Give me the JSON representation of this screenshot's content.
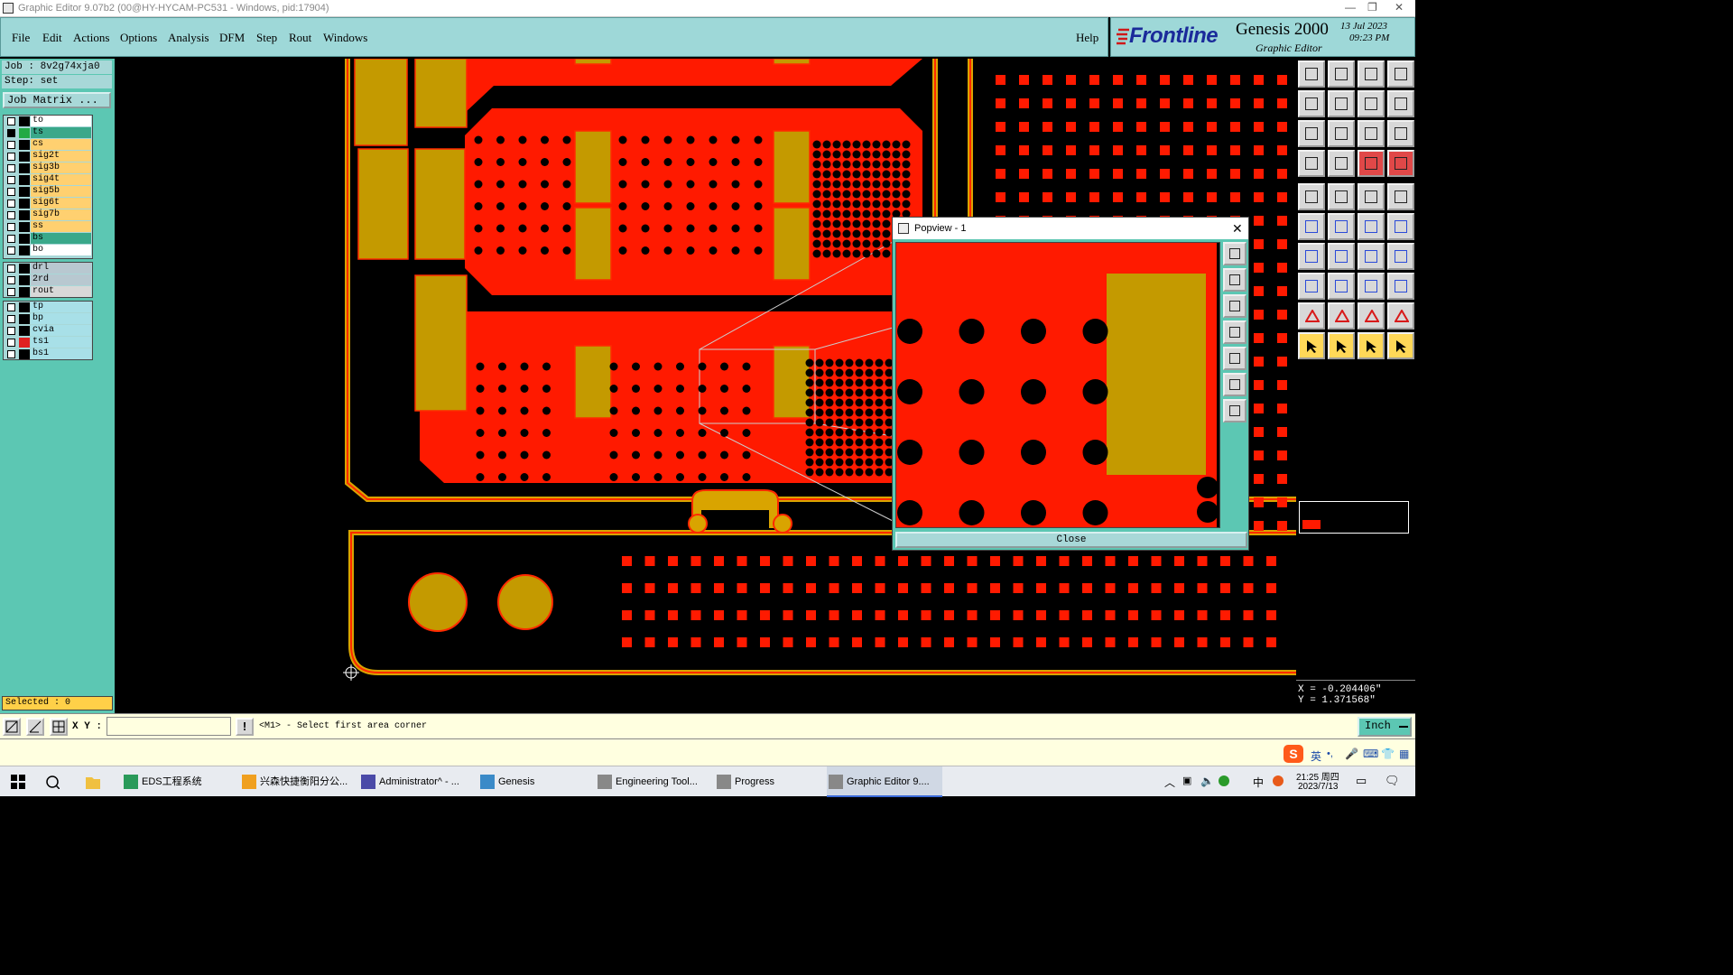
{
  "window": {
    "title": "Graphic Editor 9.07b2 (00@HY-HYCAM-PC531 - Windows, pid:17904)",
    "min": "—",
    "max": "❐",
    "close": "✕"
  },
  "menu": {
    "file": "File",
    "edit": "Edit",
    "actions": "Actions",
    "options": "Options",
    "analysis": "Analysis",
    "dfm": "DFM",
    "step": "Step",
    "rout": "Rout",
    "windows": "Windows",
    "help": "Help"
  },
  "brand": {
    "logo": "Frontline",
    "product": "Genesis 2000",
    "subtitle": "Graphic Editor",
    "date": "13 Jul 2023",
    "time": "09:23 PM"
  },
  "job": {
    "job_line": "Job : 8v2g74xja0",
    "step_line": "Step: set",
    "matrix_button": "Job Matrix ..."
  },
  "layers_group1": [
    {
      "name": "to",
      "color": "#ffffff",
      "swatch": "#000000",
      "checked": false
    },
    {
      "name": "ts",
      "color": "#3aa88a",
      "swatch": "#22aa44",
      "checked": true
    },
    {
      "name": "cs",
      "color": "#ffd070",
      "swatch": "#000000",
      "checked": false
    },
    {
      "name": "sig2t",
      "color": "#ffd070",
      "swatch": "#000000",
      "checked": false
    },
    {
      "name": "sig3b",
      "color": "#ffd070",
      "swatch": "#000000",
      "checked": false
    },
    {
      "name": "sig4t",
      "color": "#ffd070",
      "swatch": "#000000",
      "checked": false
    },
    {
      "name": "sig5b",
      "color": "#ffd070",
      "swatch": "#000000",
      "checked": false
    },
    {
      "name": "sig6t",
      "color": "#ffd070",
      "swatch": "#000000",
      "checked": false
    },
    {
      "name": "sig7b",
      "color": "#ffd070",
      "swatch": "#000000",
      "checked": false
    },
    {
      "name": "ss",
      "color": "#ffd070",
      "swatch": "#000000",
      "checked": false
    },
    {
      "name": "bs",
      "color": "#3aa88a",
      "swatch": "#000000",
      "checked": false
    },
    {
      "name": "bo",
      "color": "#ffffff",
      "swatch": "#000000",
      "checked": false
    }
  ],
  "layers_group2": [
    {
      "name": "drl",
      "color": "#b8c8d0",
      "swatch": "#000000",
      "checked": false
    },
    {
      "name": "2rd",
      "color": "#b8c8d0",
      "swatch": "#000000",
      "checked": false
    },
    {
      "name": "rout",
      "color": "#d8d8d8",
      "swatch": "#000000",
      "checked": false
    }
  ],
  "layers_group3": [
    {
      "name": "tp",
      "color": "#a8e0e8",
      "swatch": "#000000",
      "checked": false
    },
    {
      "name": "bp",
      "color": "#a8e0e8",
      "swatch": "#000000",
      "checked": false
    },
    {
      "name": "cvia",
      "color": "#a8e0e8",
      "swatch": "#000000",
      "checked": false
    },
    {
      "name": "ts1",
      "color": "#a8e0e8",
      "swatch": "#e02020",
      "checked": false
    },
    {
      "name": "bs1",
      "color": "#a8e0e8",
      "swatch": "#000000",
      "checked": false
    }
  ],
  "selected": "Selected : 0",
  "popview": {
    "title": "Popview - 1",
    "close_label": "Close"
  },
  "coords": {
    "x": "X = -0.204406\"",
    "y": "Y = 1.371568\""
  },
  "status": {
    "xy_label": "X Y :",
    "xy_value": "",
    "prompt": "<M1> - Select first area corner",
    "units": "Inch"
  },
  "taskbar": {
    "items": [
      "EDS工程系统",
      "兴森快捷衡阳分公...",
      "Administrator^ - ...",
      "Genesis",
      "Engineering Tool...",
      "Progress",
      "Graphic Editor 9...."
    ],
    "ime": "中",
    "ime2": "英",
    "time": "21:25 周四",
    "date": "2023/7/13"
  }
}
